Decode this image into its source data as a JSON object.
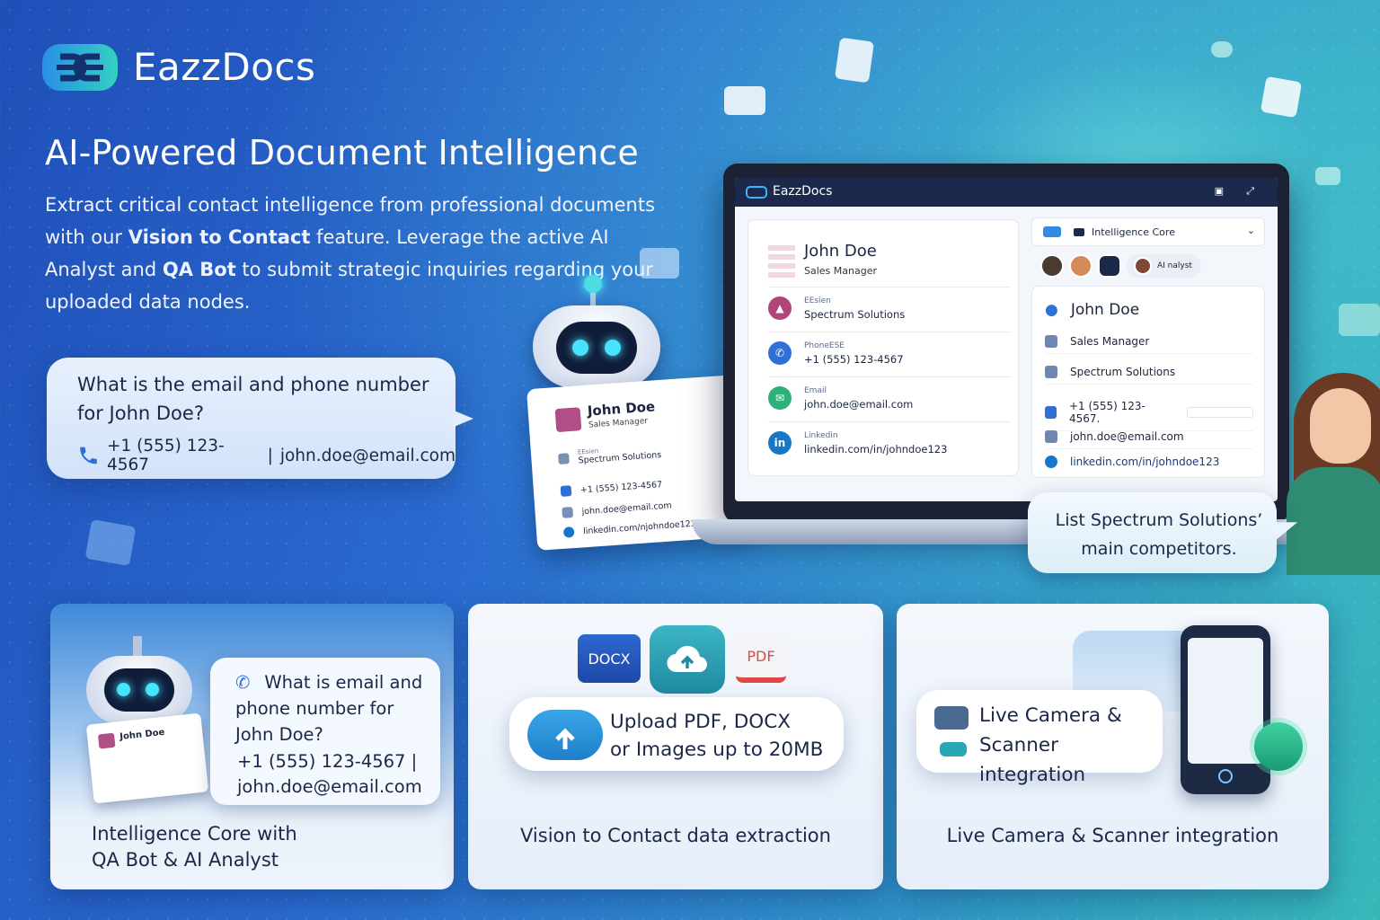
{
  "brand": {
    "name": "EazzDocs"
  },
  "hero": {
    "headline": "AI-Powered Document Intelligence",
    "intro_1": "Extract critical contact intelligence from professional documents with our ",
    "intro_bold_1": "Vision to Contact",
    "intro_2": " feature. Leverage the active AI Analyst and ",
    "intro_bold_2": "QA Bot",
    "intro_3": " to submit strategic inquiries regarding your uploaded data nodes."
  },
  "chat_left": {
    "question": "What is the email and phone number for John Doe?",
    "phone": "+1 (555) 123-4567",
    "separator": "|",
    "email": "john.doe@email.com"
  },
  "tilted_card": {
    "name": "John Doe",
    "role": "Sales Manager",
    "company_label": "EEsien",
    "company": "Spectrum Solutions",
    "phone": "+1 (555) 123-4567",
    "email": "john.doe@email.com",
    "linkedin": "linkedin.com/njohndoe123"
  },
  "laptop": {
    "app_title": "EazzDocs",
    "contact": {
      "name": "John Doe",
      "role": "Sales Manager",
      "rows": [
        {
          "label": "EEsien",
          "value": "Spectrum Solutions",
          "color": "#b0457a",
          "icon": "building-icon"
        },
        {
          "label": "PhoneESE",
          "value": "+1 (555) 123-4567",
          "color": "#2f6fd6",
          "icon": "phone-icon"
        },
        {
          "label": "Email",
          "value": "john.doe@email.com",
          "color": "#2fb07a",
          "icon": "mail-icon"
        },
        {
          "label": "Linkedin",
          "value": "linkedin.com/in/johndoe123",
          "color": "#1677c9",
          "icon": "linkedin-icon"
        }
      ]
    },
    "intel": {
      "tab_label": "Intelligence Core",
      "ai_chip": "AI nalyst",
      "name": "John Doe",
      "role": "Sales Manager",
      "company": "Spectrum Solutions",
      "phone": "+1 (555) 123-4567.",
      "email": "john.doe@email.com",
      "linkedin": "linkedin.com/in/johndoe123"
    }
  },
  "chat_right": {
    "question": "List Spectrum Solutions’ main competitors."
  },
  "panels": {
    "p1": {
      "question": "What is email and phone number for John Doe?",
      "answer_1": "+1 (555) 123-4567 |",
      "answer_2": "john.doe@email.com",
      "card_name": "John Doe",
      "caption_1": "Intelligence Core with",
      "caption_2": "QA Bot & AI Analyst"
    },
    "p2": {
      "badge_docx": "DOCX",
      "badge_pdf": "PDF",
      "upload_1": "Upload PDF, DOCX",
      "upload_2": "or Images up to 20MB",
      "caption": "Vision to Contact data extraction"
    },
    "p3": {
      "pill_1": "Live Camera &",
      "pill_2": "Scanner integration",
      "caption": "Live Camera & Scanner integration"
    }
  },
  "colors": {
    "accent_teal": "#37b9b8",
    "brand_blue": "#2a6bd0",
    "pdf_red": "#e04848",
    "docx_blue": "#2656b8"
  }
}
